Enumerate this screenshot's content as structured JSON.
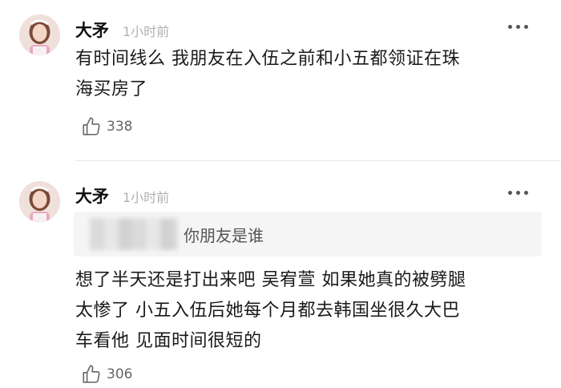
{
  "comments": [
    {
      "username": "大矛",
      "time": "1小时前",
      "text_lines": [
        "有时间线么 我朋友在入伍之前和小五都领证在珠",
        "海买房了"
      ],
      "likes": "338"
    },
    {
      "username": "大矛",
      "time": "1小时前",
      "quote": "你朋友是谁",
      "text_lines": [
        "想了半天还是打出来吧 吴宥萱  如果她真的被劈腿",
        "太惨了  小五入伍后她每个月都去韩国坐很久大巴",
        "车看他 见面时间很短的"
      ],
      "likes": "306"
    }
  ],
  "icons": {
    "like": "thumbs-up-icon",
    "more": "more-dots-icon",
    "avatar": "user-avatar"
  }
}
